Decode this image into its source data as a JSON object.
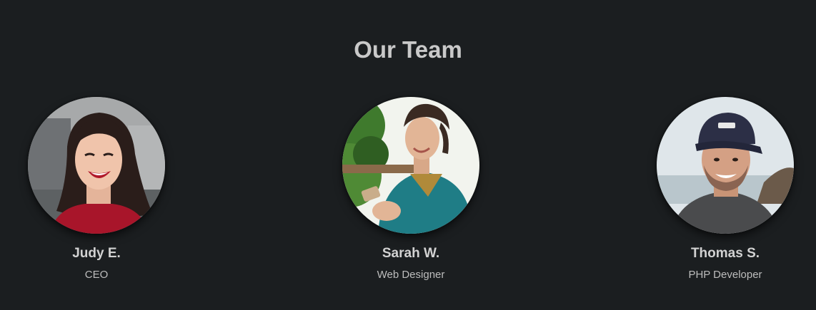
{
  "section": {
    "title": "Our Team"
  },
  "members": [
    {
      "name": "Judy E.",
      "role": "CEO",
      "photo": "portrait-photo"
    },
    {
      "name": "Sarah W.",
      "role": "Web Designer",
      "photo": "portrait-photo"
    },
    {
      "name": "Thomas S.",
      "role": "PHP Developer",
      "photo": "portrait-photo"
    }
  ],
  "colors": {
    "background": "#1b1e20",
    "title": "#c9c9c9",
    "name": "#d2d2d2",
    "role": "#bdbdbd"
  }
}
